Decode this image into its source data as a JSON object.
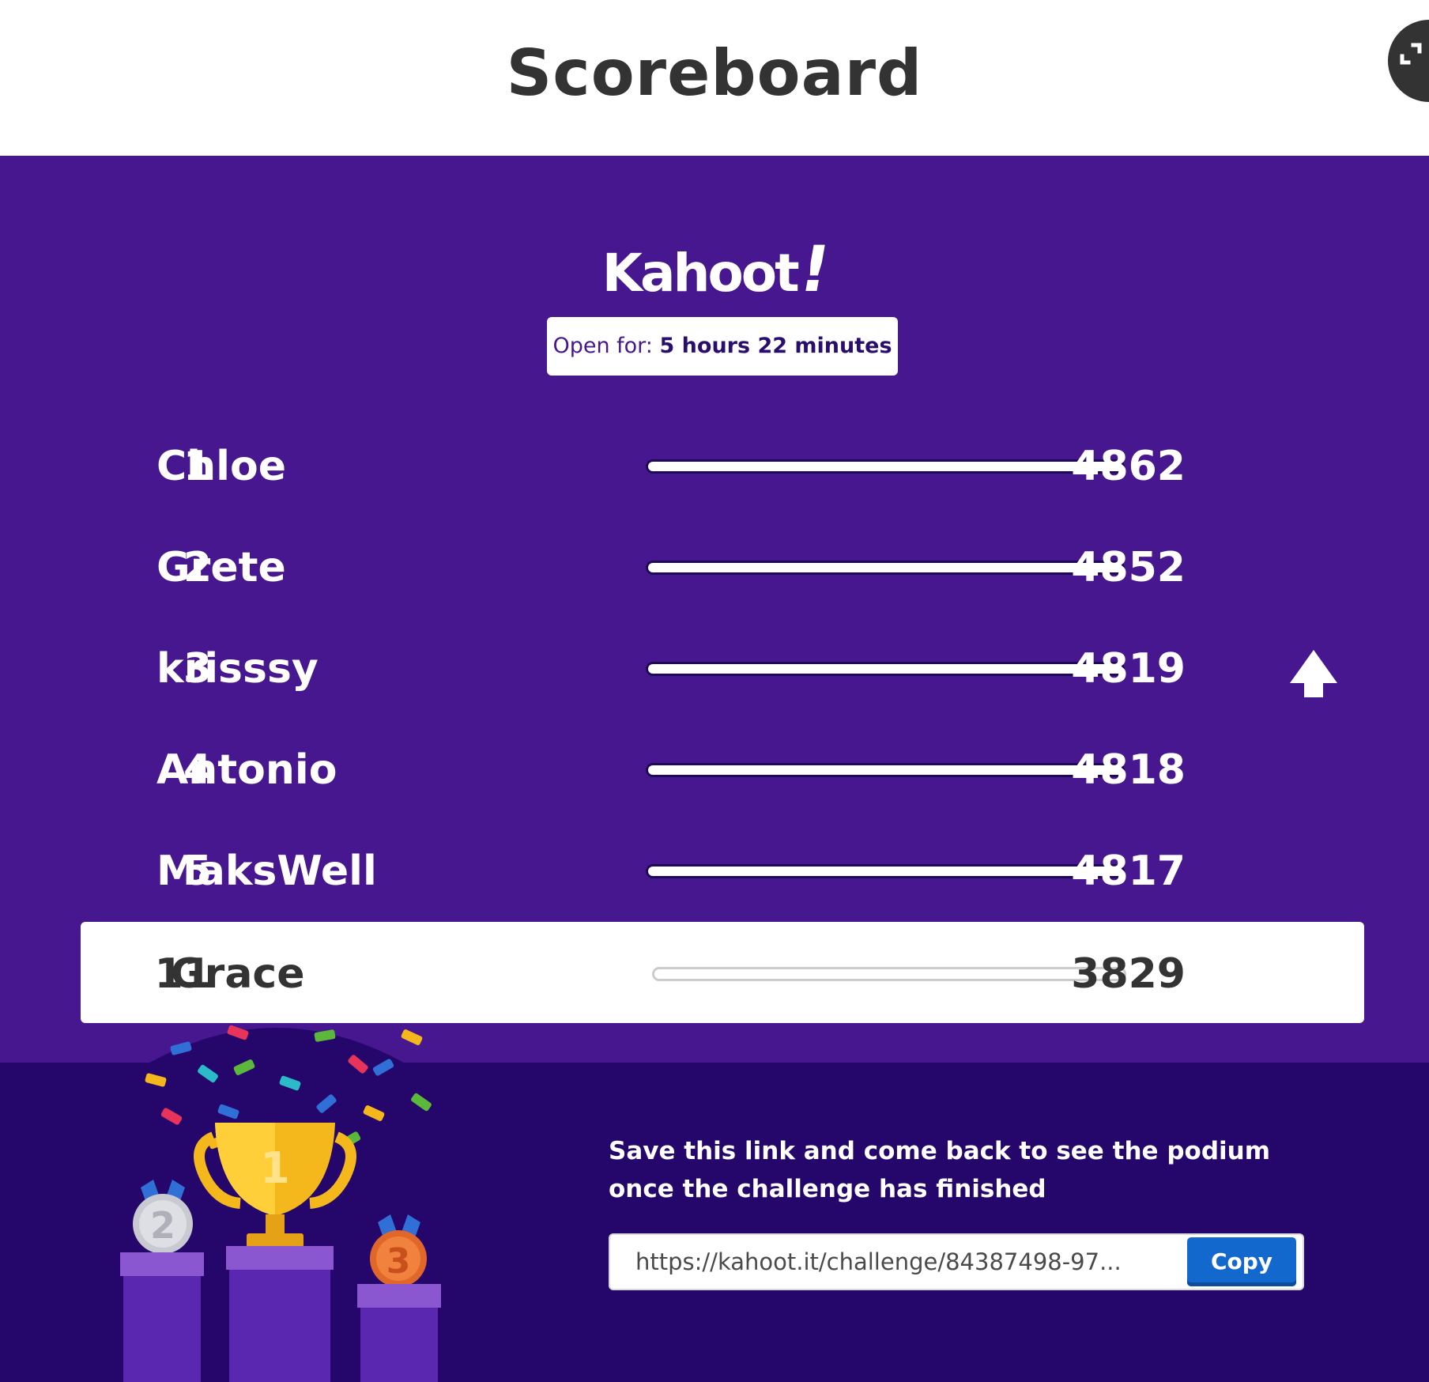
{
  "header": {
    "title": "Scoreboard"
  },
  "brand": {
    "logo_text": "Kahoot",
    "logo_suffix": "!"
  },
  "timer": {
    "label": "Open for:",
    "value": "5 hours 22 minutes"
  },
  "leaderboard": [
    {
      "rank": "1",
      "name": "Chloe",
      "score": "4862",
      "trend": ""
    },
    {
      "rank": "2",
      "name": "Grete",
      "score": "4852",
      "trend": ""
    },
    {
      "rank": "3",
      "name": "krisssy",
      "score": "4819",
      "trend": "up"
    },
    {
      "rank": "4",
      "name": "Antonio",
      "score": "4818",
      "trend": ""
    },
    {
      "rank": "5",
      "name": "MaksWell",
      "score": "4817",
      "trend": ""
    }
  ],
  "current_player": {
    "rank": "11",
    "name": "Grace",
    "score": "3829"
  },
  "footer": {
    "save_message": "Save this link and come back to see the podium once the challenge has finished",
    "link_value": "https://kahoot.it/challenge/84387498-97...",
    "copy_label": "Copy",
    "podium_labels": [
      "1",
      "2",
      "3"
    ]
  },
  "colors": {
    "main_bg": "#46178f",
    "footer_bg": "#25076b",
    "copy_button": "#1368ce",
    "gold": "#f5b81c",
    "silver": "#c9c9d1",
    "bronze": "#e0662a"
  },
  "icons": {
    "expand": "expand-icon",
    "trend_up": "arrow-up-icon",
    "podium": "podium-trophy-illustration"
  }
}
